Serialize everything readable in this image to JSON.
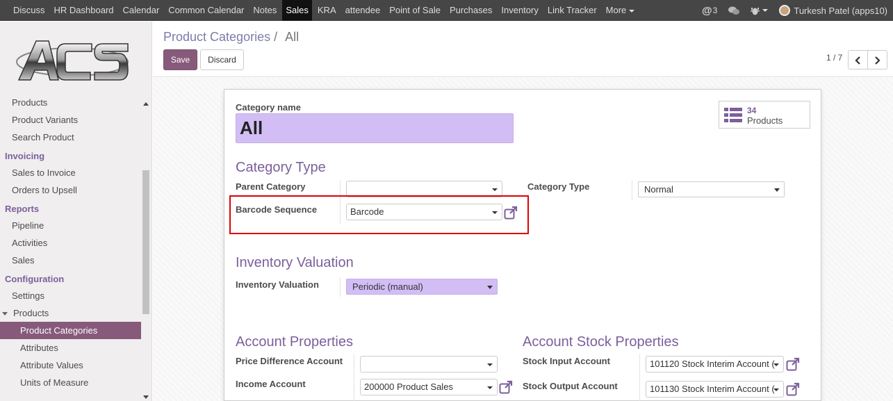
{
  "topbar": {
    "menu": [
      "Discuss",
      "HR Dashboard",
      "Calendar",
      "Common Calendar",
      "Notes",
      "Sales",
      "KRA",
      "attendee",
      "Point of Sale",
      "Purchases",
      "Inventory",
      "Link Tracker",
      "More"
    ],
    "active": "Sales",
    "mentions_count": "3",
    "user": "Turkesh Patel (apps10)"
  },
  "sidebar": {
    "items": {
      "products": "Products",
      "product_variants": "Product Variants",
      "search_product": "Search Product",
      "invoicing": "Invoicing",
      "sales_to_invoice": "Sales to Invoice",
      "orders_to_upsell": "Orders to Upsell",
      "reports": "Reports",
      "pipeline": "Pipeline",
      "activities": "Activities",
      "sales": "Sales",
      "configuration": "Configuration",
      "settings": "Settings",
      "products_group": "Products",
      "product_categories": "Product Categories",
      "attributes": "Attributes",
      "attribute_values": "Attribute Values",
      "units_of_measure": "Units of Measure"
    }
  },
  "control_panel": {
    "breadcrumb_parent": "Product Categories",
    "breadcrumb_sep": "/",
    "breadcrumb_current": "All",
    "save_label": "Save",
    "discard_label": "Discard",
    "pager": "1 / 7"
  },
  "form": {
    "stat_count": "34",
    "stat_label": "Products",
    "category_name_label": "Category name",
    "category_name": "All",
    "sec_category_type": "Category Type",
    "parent_category_label": "Parent Category",
    "parent_category_value": "",
    "category_type_label": "Category Type",
    "category_type_value": "Normal",
    "barcode_sequence_label": "Barcode Sequence",
    "barcode_sequence_value": "Barcode",
    "sec_inventory_valuation": "Inventory Valuation",
    "inventory_valuation_label": "Inventory Valuation",
    "inventory_valuation_value": "Periodic (manual)",
    "sec_account_properties": "Account Properties",
    "price_difference_label": "Price Difference Account",
    "price_difference_value": "",
    "income_account_label": "Income Account",
    "income_account_value": "200000 Product Sales",
    "sec_account_stock": "Account Stock Properties",
    "stock_input_label": "Stock Input Account",
    "stock_input_value": "101120 Stock Interim Account (",
    "stock_output_label": "Stock Output Account",
    "stock_output_value": "101130 Stock Interim Account ("
  },
  "colors": {
    "brand": "#875a7b",
    "section": "#7c5f9b",
    "field_highlight": "#d2bdf5",
    "annotation": "#e00000"
  }
}
